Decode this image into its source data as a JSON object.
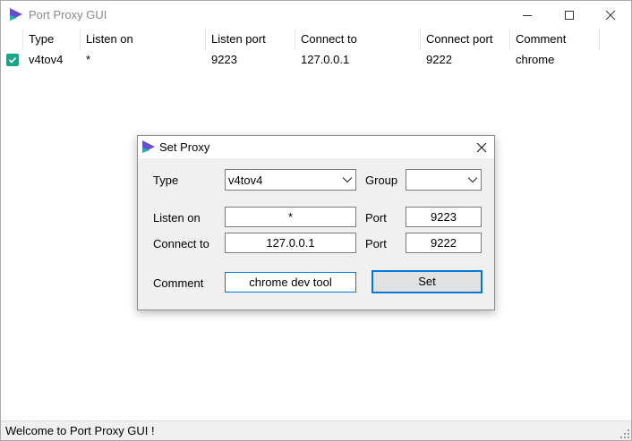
{
  "window": {
    "title": "Port Proxy GUI",
    "status": "Welcome to Port Proxy GUI !"
  },
  "columns": [
    {
      "label": "Type"
    },
    {
      "label": "Listen on"
    },
    {
      "label": "Listen port"
    },
    {
      "label": "Connect to"
    },
    {
      "label": "Connect port"
    },
    {
      "label": "Comment"
    }
  ],
  "rows": [
    {
      "checked": true,
      "type": "v4tov4",
      "listen_on": "*",
      "listen_port": "9223",
      "connect_to": "127.0.0.1",
      "connect_port": "9222",
      "comment": "chrome"
    }
  ],
  "dialog": {
    "title": "Set Proxy",
    "type_label": "Type",
    "type_value": "v4tov4",
    "group_label": "Group",
    "group_value": "",
    "listen_on_label": "Listen on",
    "listen_on_value": "*",
    "listen_port_label": "Port",
    "listen_port_value": "9223",
    "connect_to_label": "Connect to",
    "connect_to_value": "127.0.0.1",
    "connect_port_label": "Port",
    "connect_port_value": "9222",
    "comment_label": "Comment",
    "comment_value": "chrome dev tool",
    "set_label": "Set"
  },
  "icons": {
    "app": "app-logo-icon",
    "minimize": "minimize-icon",
    "maximize": "maximize-icon",
    "close": "close-icon",
    "check": "checkbox-checked-icon",
    "dropdown": "chevron-down-icon"
  },
  "colors": {
    "accent": "#0078d7",
    "check": "#1aa586",
    "logo_purple": "#6a4bd8",
    "logo_teal": "#14b8a6"
  }
}
